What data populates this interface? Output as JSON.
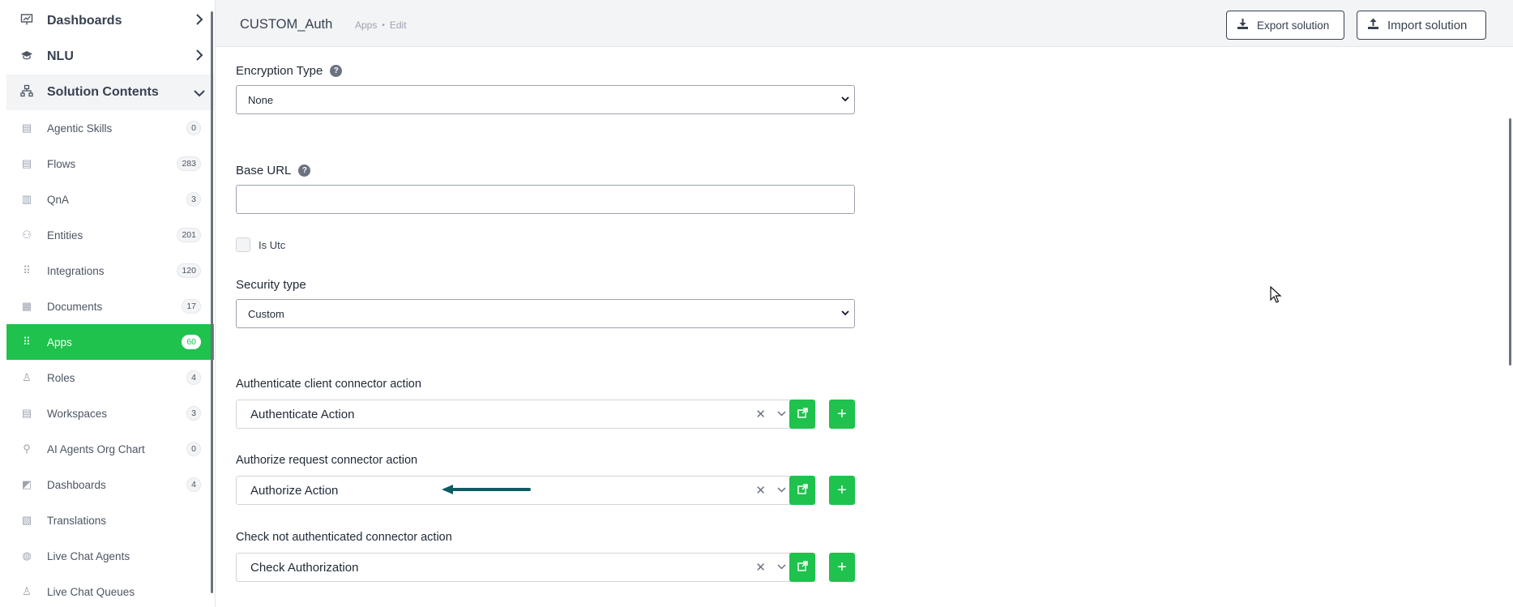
{
  "sidebar": {
    "top": [
      {
        "label": "Dashboards",
        "icon": "chart-presentation-icon"
      },
      {
        "label": "NLU",
        "icon": "graduation-cap-icon"
      },
      {
        "label": "Solution Contents",
        "icon": "sitemap-icon"
      }
    ],
    "items": [
      {
        "label": "Agentic Skills",
        "count": "0",
        "icon": "list-icon"
      },
      {
        "label": "Flows",
        "count": "283",
        "icon": "list-icon"
      },
      {
        "label": "QnA",
        "count": "3",
        "icon": "book-icon"
      },
      {
        "label": "Entities",
        "count": "201",
        "icon": "network-icon"
      },
      {
        "label": "Integrations",
        "count": "120",
        "icon": "grid-icon"
      },
      {
        "label": "Documents",
        "count": "17",
        "icon": "document-icon"
      },
      {
        "label": "Apps",
        "count": "60",
        "icon": "apps-grid-icon",
        "active": true
      },
      {
        "label": "Roles",
        "count": "4",
        "icon": "user-icon"
      },
      {
        "label": "Workspaces",
        "count": "3",
        "icon": "list-icon"
      },
      {
        "label": "AI Agents Org Chart",
        "count": "0",
        "icon": "org-chart-icon"
      },
      {
        "label": "Dashboards",
        "count": "4",
        "icon": "chart-icon"
      },
      {
        "label": "Translations",
        "count": "",
        "icon": "translate-icon"
      },
      {
        "label": "Live Chat Agents",
        "count": "",
        "icon": "headset-icon"
      },
      {
        "label": "Live Chat Queues",
        "count": "",
        "icon": "queue-icon"
      }
    ]
  },
  "header": {
    "title": "CUSTOM_Auth",
    "crumb_app": "Apps",
    "crumb_sep": "•",
    "crumb_edit": "Edit",
    "export_label": "Export solution",
    "import_label": "Import solution"
  },
  "form": {
    "encryption_label": "Encryption Type",
    "encryption_value": "None",
    "base_url_label": "Base URL",
    "base_url_value": "",
    "is_utc_label": "Is Utc",
    "is_utc_checked": false,
    "security_label": "Security type",
    "security_value": "Custom",
    "authenticate_label": "Authenticate client connector action",
    "authenticate_value": "Authenticate Action",
    "authorize_label": "Authorize request connector action",
    "authorize_value": "Authorize Action",
    "check_label": "Check not authenticated connector action",
    "check_value": "Check Authorization"
  },
  "colors": {
    "accent": "#1ec24c",
    "annotation_arrow": "#0f5c63",
    "header_bg": "#f3f4f6"
  }
}
